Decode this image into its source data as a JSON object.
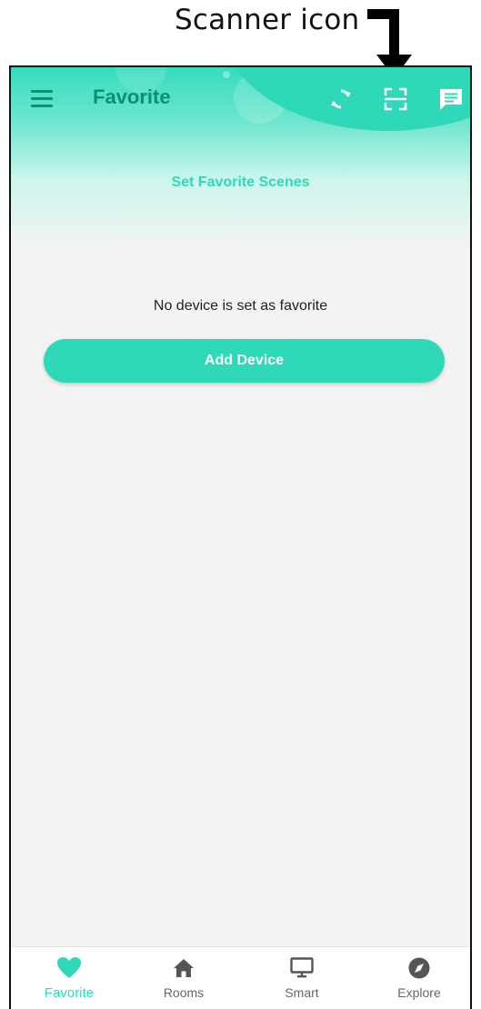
{
  "annotation": {
    "label": "Scanner icon"
  },
  "header": {
    "title": "Favorite",
    "set_favorite_scenes": "Set Favorite Scenes",
    "icons": [
      "menu-icon",
      "sync-icon",
      "scanner-icon",
      "message-icon"
    ]
  },
  "main": {
    "empty_message": "No device is set as favorite",
    "add_device_label": "Add Device"
  },
  "bottom_nav": {
    "items": [
      {
        "label": "Favorite",
        "icon": "heart-icon",
        "active": true
      },
      {
        "label": "Rooms",
        "icon": "home-icon",
        "active": false
      },
      {
        "label": "Smart",
        "icon": "monitor-icon",
        "active": false
      },
      {
        "label": "Explore",
        "icon": "compass-icon",
        "active": false
      }
    ]
  },
  "colors": {
    "accent": "#2fd8b8",
    "title": "#0c8f72",
    "background": "#f3f3f3",
    "nav_inactive": "#666666"
  }
}
